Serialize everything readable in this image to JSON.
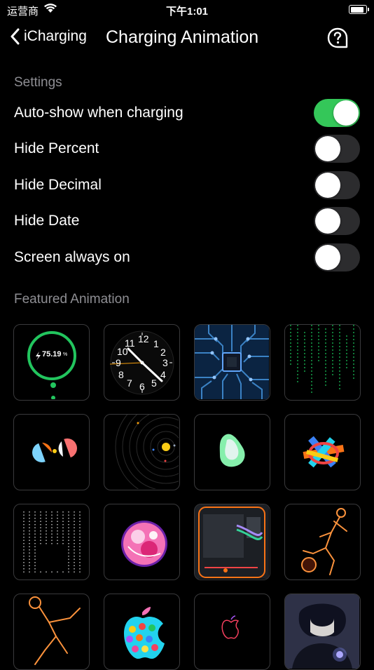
{
  "status": {
    "carrier": "运营商",
    "time": "下午1:01"
  },
  "nav": {
    "back_label": "iCharging",
    "title": "Charging Animation"
  },
  "settings": {
    "section_label": "Settings",
    "items": [
      {
        "label": "Auto-show when charging",
        "on": true
      },
      {
        "label": "Hide Percent",
        "on": false
      },
      {
        "label": "Hide Decimal",
        "on": false
      },
      {
        "label": "Hide Date",
        "on": false
      },
      {
        "label": "Screen always on",
        "on": false
      }
    ]
  },
  "featured": {
    "section_label": "Featured Animation",
    "battery_percent_text": "75.19",
    "percent_sign": "%",
    "clock_numbers": [
      "12",
      "1",
      "2",
      "3",
      "4",
      "5",
      "6",
      "7",
      "8",
      "9",
      "10",
      "11"
    ],
    "colors": {
      "accent_green": "#34c759",
      "ring_green": "#22c55e",
      "toggle_off": "#2c2c2e"
    }
  }
}
